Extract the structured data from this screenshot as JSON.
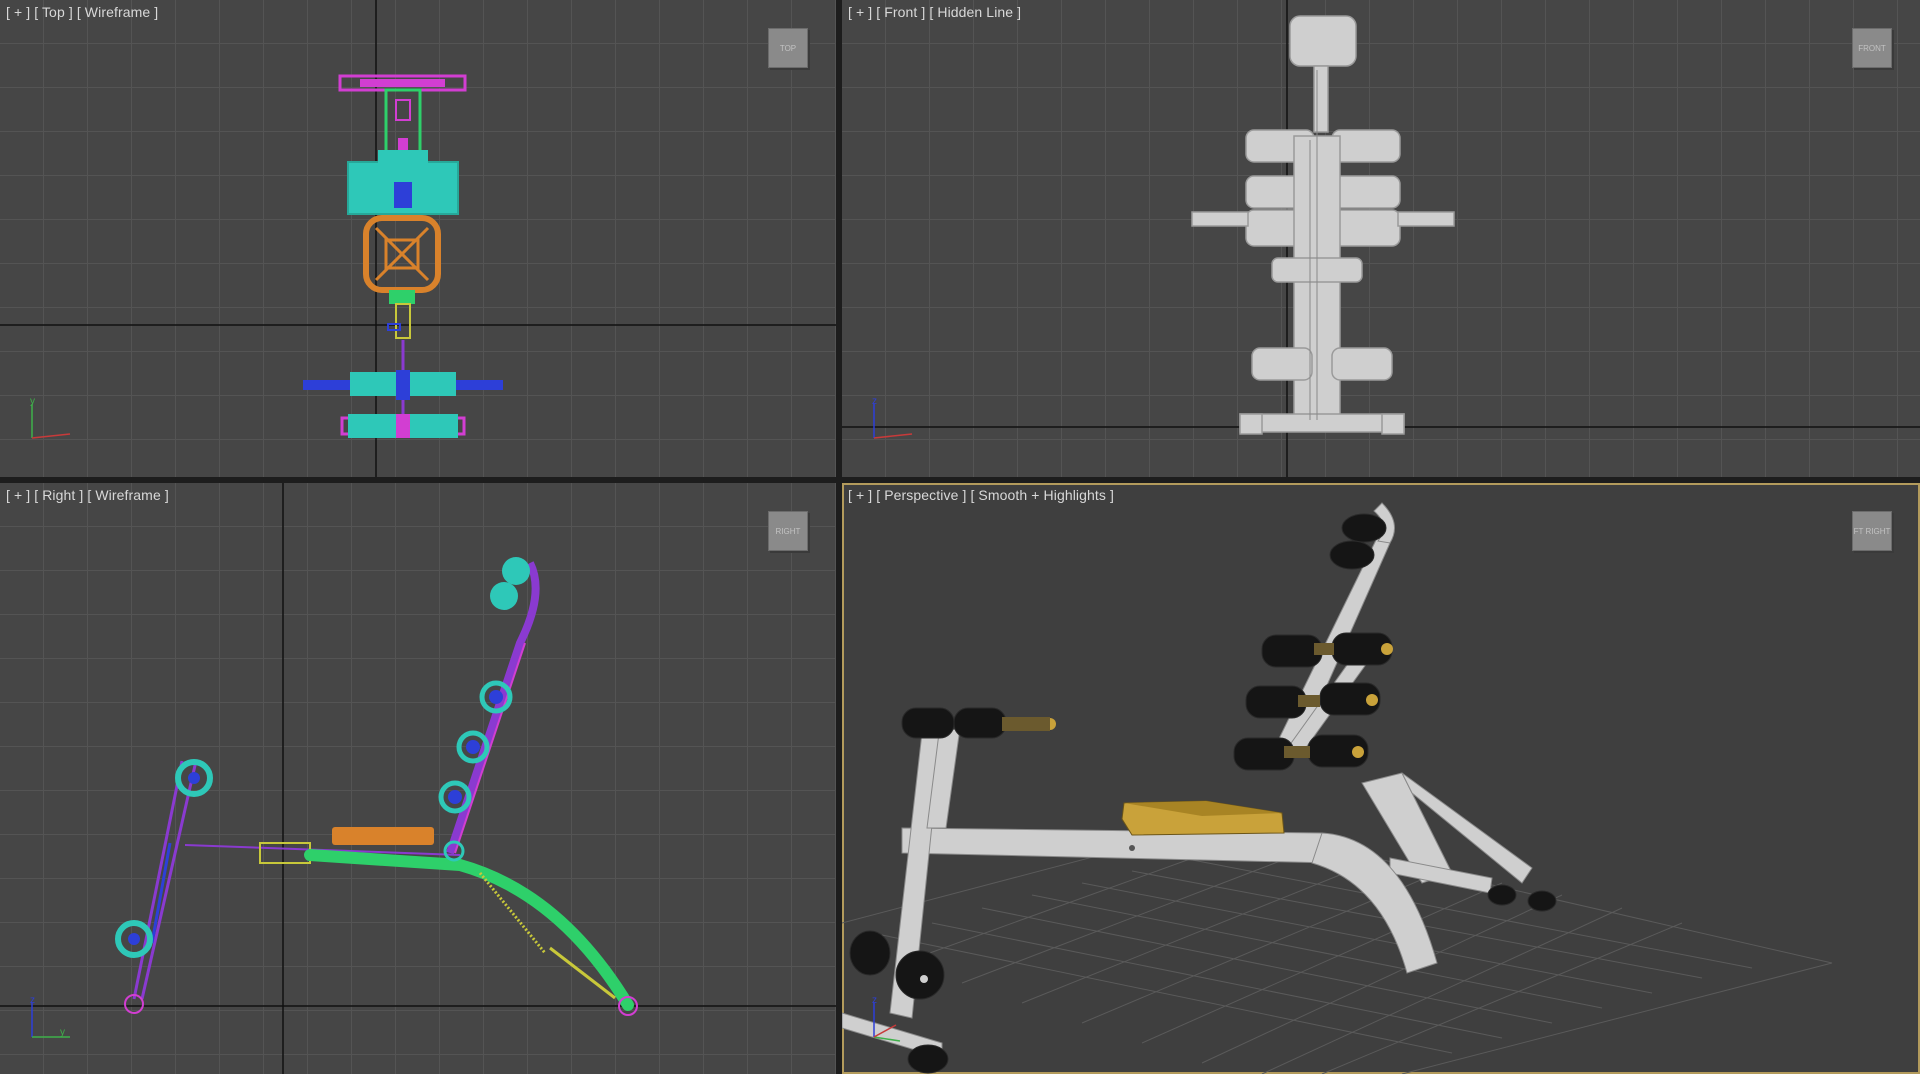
{
  "viewports": {
    "top": {
      "plus": "[ + ]",
      "name": "[ Top ]",
      "mode": "[ Wireframe ]",
      "cube": "TOP"
    },
    "front": {
      "plus": "[ + ]",
      "name": "[ Front ]",
      "mode": "[ Hidden Line ]",
      "cube": "FRONT"
    },
    "right": {
      "plus": "[ + ]",
      "name": "[ Right ]",
      "mode": "[ Wireframe ]",
      "cube": "RIGHT"
    },
    "persp": {
      "plus": "[ + ]",
      "name": "[ Perspective ]",
      "mode": "[ Smooth + Highlights ]",
      "cube": "FT RIGHT"
    }
  },
  "axis_labels": {
    "y": "y",
    "z": "z",
    "x": "x"
  },
  "colors": {
    "grid_bg": "#464646",
    "grid_line": "#545454",
    "active_border": "#b39b5c",
    "cyan": "#2ec8b8",
    "green": "#2ed06a",
    "magenta": "#d23ed2",
    "blue": "#2d3fd8",
    "orange": "#d9822b",
    "purple": "#8a3ad0",
    "yellow": "#c8c83a",
    "hidden_line": "#d6d6d6",
    "metal": "#cfcfcf",
    "pad": "#151515",
    "gold": "#c9a23a"
  }
}
